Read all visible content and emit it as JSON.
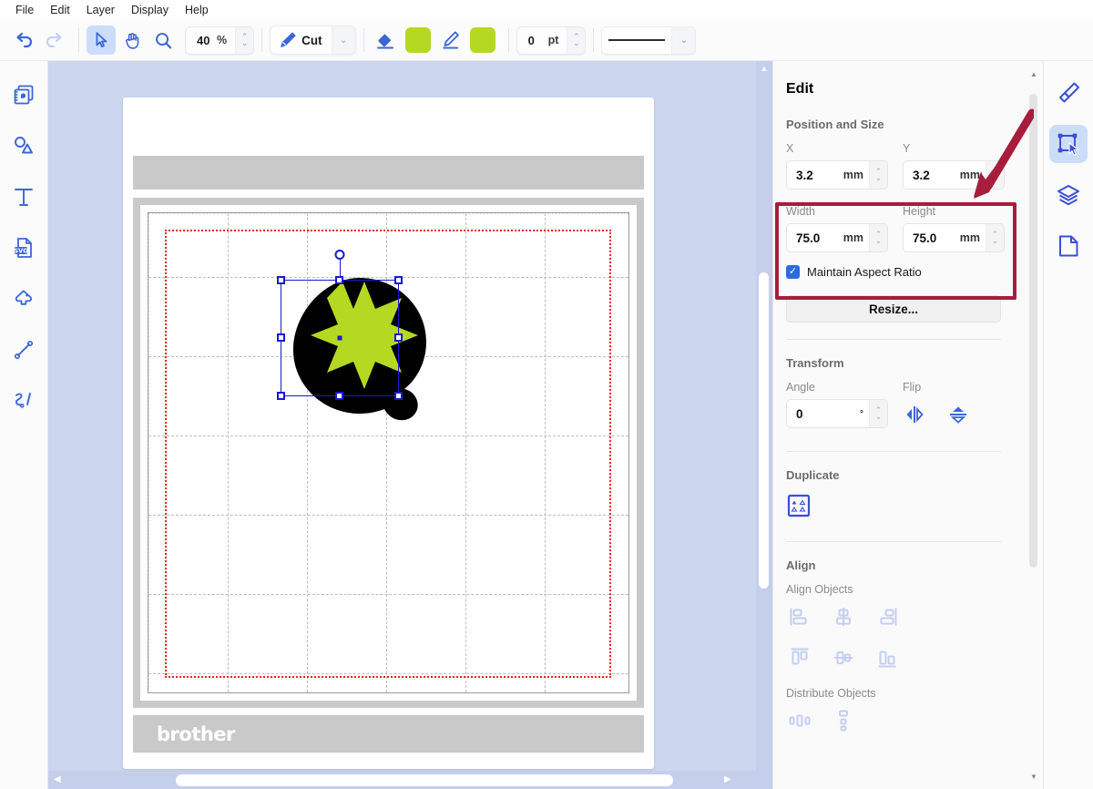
{
  "menubar": {
    "items": [
      "File",
      "Edit",
      "Layer",
      "Display",
      "Help"
    ]
  },
  "toolbar": {
    "undo_icon": "undo-icon",
    "redo_icon": "redo-icon",
    "select_icon": "cursor-select-icon",
    "pan_icon": "hand-pan-icon",
    "zoom_icon": "magnifier-zoom-icon",
    "zoom_value": "40",
    "zoom_unit": "%",
    "cut_label": "Cut",
    "cut_icon": "pen-cut-icon",
    "fill_icon": "paint-bucket-icon",
    "fill_color": "#b5d822",
    "line_icon": "pencil-line-icon",
    "line_color": "#b5d822",
    "stroke_value": "0",
    "stroke_unit": "pt",
    "line_style": "solid-line"
  },
  "left_rail": {
    "items": [
      {
        "name": "sticker-pattern-icon",
        "label": "Patterns"
      },
      {
        "name": "shapes-icon",
        "label": "Shapes"
      },
      {
        "name": "text-icon",
        "label": "Text"
      },
      {
        "name": "svg-import-icon",
        "label": "SVG"
      },
      {
        "name": "stamp-shape-icon",
        "label": "Stamp"
      },
      {
        "name": "line-draw-icon",
        "label": "Line"
      },
      {
        "name": "freehand-draw-icon",
        "label": "Freehand"
      }
    ]
  },
  "canvas": {
    "mat_brand": "brother",
    "object_fill_color": "#000000",
    "star_color": "#b5d822",
    "selection_color": "#1919d0",
    "cut_border_color": "#ee2222"
  },
  "panel": {
    "title": "Edit",
    "position_and_size": {
      "heading": "Position and Size",
      "x_label": "X",
      "x_value": "3.2",
      "x_unit": "mm",
      "y_label": "Y",
      "y_value": "3.2",
      "y_unit": "mm",
      "width_label": "Width",
      "width_value": "75.0",
      "width_unit": "mm",
      "height_label": "Height",
      "height_value": "75.0",
      "height_unit": "mm",
      "aspect_label": "Maintain Aspect Ratio",
      "aspect_checked": true,
      "resize_label": "Resize..."
    },
    "transform": {
      "heading": "Transform",
      "angle_label": "Angle",
      "angle_value": "0",
      "angle_unit": "°",
      "flip_label": "Flip",
      "flip_h_icon": "flip-horizontal-icon",
      "flip_v_icon": "flip-vertical-icon"
    },
    "duplicate": {
      "heading": "Duplicate",
      "icon": "duplicate-grid-icon"
    },
    "align": {
      "heading": "Align",
      "objects_label": "Align Objects",
      "icons": [
        "align-left-icon",
        "align-center-horizontal-icon",
        "align-right-icon",
        "align-top-icon",
        "align-middle-vertical-icon",
        "align-bottom-icon"
      ],
      "distribute_label": "Distribute Objects",
      "distribute_icons": [
        "distribute-horizontal-icon",
        "distribute-vertical-icon"
      ]
    }
  },
  "right_rail": {
    "items": [
      {
        "name": "brush-properties-icon",
        "active": false
      },
      {
        "name": "edit-select-icon",
        "active": true
      },
      {
        "name": "layers-icon",
        "active": false
      },
      {
        "name": "document-page-icon",
        "active": false
      }
    ]
  },
  "annotation": {
    "highlight_color": "#a71d3c",
    "arrow_icon": "annotation-arrow-icon"
  }
}
